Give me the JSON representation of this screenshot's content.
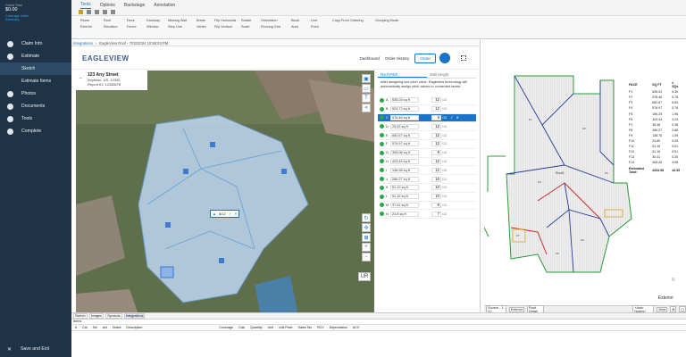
{
  "sidebar": {
    "grand_total_label": "Grand Total",
    "grand_total_value": "$0.00",
    "coverage_link": "Coverage Limits",
    "summary_link": "Summary",
    "items": [
      {
        "label": "Claim Info",
        "icon": "info-icon"
      },
      {
        "label": "Estimate",
        "icon": "estimate-icon"
      },
      {
        "label": "Sketch",
        "sub": true
      },
      {
        "label": "Estimate Items",
        "sub": true
      },
      {
        "label": "Photos",
        "icon": "photo-icon"
      },
      {
        "label": "Documents",
        "icon": "document-icon"
      },
      {
        "label": "Tools",
        "icon": "wrench-icon"
      },
      {
        "label": "Complete",
        "icon": "check-icon"
      }
    ],
    "save_exit": "Save and Exit"
  },
  "tabs": [
    "Tools",
    "Options",
    "Backstage",
    "Annotation"
  ],
  "ribbon": {
    "col1": [
      "Room",
      "Exterior"
    ],
    "col2": [
      "Roof",
      "Elevation"
    ],
    "col3": [
      "Deck",
      "Fence"
    ],
    "col4": [
      "Doorway",
      "Window"
    ],
    "col5": [
      "Missing Wall",
      "Step Line"
    ],
    "col6": [
      "Break",
      "Vertex"
    ],
    "col7": [
      "Flip Horizontal",
      "Flip Vertical"
    ],
    "col8": [
      "Rotate",
      "Scale"
    ],
    "col9": [
      "Orientation",
      "Flooring Grid"
    ],
    "col10": [
      "Block",
      "Area"
    ],
    "col11": [
      "Line",
      "Point"
    ],
    "col12": "Copy From Ordering",
    "col13": "Grouping Mode"
  },
  "breadcrumb": [
    "Integrations",
    "EagleView Roof - 7/03/2024 10:58:03 PM"
  ],
  "eagleview": {
    "logo": "EAGLEVIEW",
    "nav_dashboard": "Dashboard",
    "nav_history": "Order History",
    "order_button": "Order"
  },
  "address": {
    "street": "123 Any Street",
    "city": "Anytown, US, 12345",
    "report": "Report ID: 12345678"
  },
  "map": {
    "pitch_badge": "8/12",
    "low_slope_label": "LOW SLOPE",
    "scale_label": "UR"
  },
  "panel": {
    "tab_roof": "Roof Pitch",
    "tab_wall": "Wall Height",
    "info": "After assigning one pitch value, Eagleview technology will automatically assign pitch values to connected facets.",
    "facets": [
      {
        "letter": "A",
        "sq": "535.03 sq ft",
        "pitch": "12"
      },
      {
        "letter": "B",
        "sq": "924.72 sq ft",
        "pitch": "12"
      },
      {
        "letter": "C",
        "sq": "976.46 sq ft",
        "pitch": "8",
        "selected": true
      },
      {
        "letter": "D",
        "sq": "29.93 sq ft",
        "pitch": "12"
      },
      {
        "letter": "E",
        "sq": "682.67 sq ft",
        "pitch": "12"
      },
      {
        "letter": "F",
        "sq": "576.97 sq ft",
        "pitch": "12"
      },
      {
        "letter": "G",
        "sq": "306.06 sq ft",
        "pitch": "8"
      },
      {
        "letter": "H",
        "sq": "423.44 sq ft",
        "pitch": "12"
      },
      {
        "letter": "I",
        "sq": "138.96 sq ft",
        "pitch": "12"
      },
      {
        "letter": "J",
        "sq": "286.27 sq ft",
        "pitch": "10"
      },
      {
        "letter": "K",
        "sq": "51.19 sq ft",
        "pitch": "10"
      },
      {
        "letter": "L",
        "sq": "51.16 sq ft",
        "pitch": "10"
      },
      {
        "letter": "M",
        "sq": "37.61 sq ft",
        "pitch": "8"
      },
      {
        "letter": "N",
        "sq": "24.8 sq ft",
        "pitch": "7"
      }
    ],
    "pitch_suffix": "/12",
    "cancel": "Cancel",
    "save": "Save"
  },
  "footnote": "This information is provided by a third party. Please contact the third party with any questions or issues.",
  "copyright": "© 2024 Eagle View Technologies, Inc. All Rights Reserved. | Terms of Use | Privacy Policy",
  "bottom_tabs": [
    "Sketch",
    "Images",
    "Symbols",
    "Integrations"
  ],
  "items_title": "Items",
  "items_cols": [
    "#",
    "Cat",
    "Sel",
    "Act",
    "Notes",
    "Description",
    "Coverage",
    "Calc",
    "Quantity",
    "Unit",
    "Unit Price",
    "Sales Tax",
    "RCV",
    "Depreciation",
    "ACV"
  ],
  "drawing": {
    "table_header": [
      "FACE",
      "SQ FT",
      "# SQs",
      "Slope - Ri"
    ],
    "rows": [
      [
        "F1",
        "535.03",
        "5.35"
      ],
      [
        "F2",
        "976.46",
        "9.76"
      ],
      [
        "F3",
        "682.67",
        "6.83"
      ],
      [
        "F4",
        "576.97",
        "5.76"
      ],
      [
        "F5",
        "196.25",
        "1.96"
      ],
      [
        "F6",
        "423.44",
        "4.24"
      ],
      [
        "F7",
        "38.48",
        "0.38"
      ],
      [
        "F8",
        "286.27",
        "2.86"
      ],
      [
        "F9",
        "138.76",
        "1.39"
      ],
      [
        "F10",
        "24.80",
        "0.25"
      ],
      [
        "F11",
        "51.19",
        "0.51"
      ],
      [
        "F12",
        "51.16",
        "0.51"
      ],
      [
        "F13",
        "30.41",
        "0.30"
      ],
      [
        "F14",
        "406.45",
        "4.06"
      ]
    ],
    "total_label": "Estimated Total:",
    "total_sqft": "4334.98",
    "total_sqs": "43.35",
    "room_label": "Exterior",
    "bottom_select": "Source - 1 (1)",
    "bottom_tab": "Exterior",
    "bottom_tab2": "Roof Detail",
    "bottom_mode": "+Auto Nodes+",
    "bottom_view": "View"
  }
}
